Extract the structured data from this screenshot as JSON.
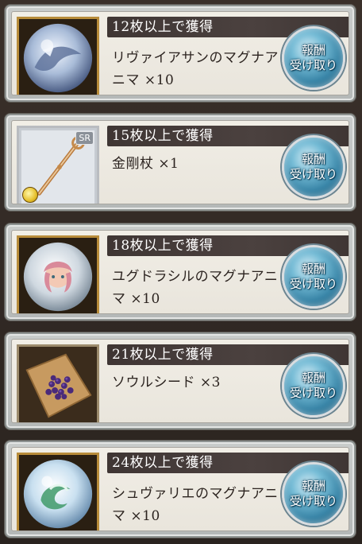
{
  "rewards": [
    {
      "threshold": "12枚以上で獲得",
      "item": "リヴァイアサンのマグナアニマ ×10",
      "icon": "leviathan-anima-icon"
    },
    {
      "threshold": "15枚以上で獲得",
      "item": "金剛杖 ×1",
      "icon": "staff-weapon-icon",
      "rarity": "SR"
    },
    {
      "threshold": "18枚以上で獲得",
      "item": "ユグドラシルのマグナアニマ ×10",
      "icon": "yggdrasil-anima-icon"
    },
    {
      "threshold": "21枚以上で獲得",
      "item": "ソウルシード ×3",
      "icon": "soul-seed-icon"
    },
    {
      "threshold": "24枚以上で獲得",
      "item": "シュヴァリエのマグナアニマ ×10",
      "icon": "chevalier-anima-icon"
    }
  ],
  "claim_button": {
    "line1": "報酬",
    "line2": "受け取り"
  },
  "colors": {
    "button": "#3a86a8",
    "header_bar": "#3f3634",
    "frame_gold": "#b88c3a"
  }
}
